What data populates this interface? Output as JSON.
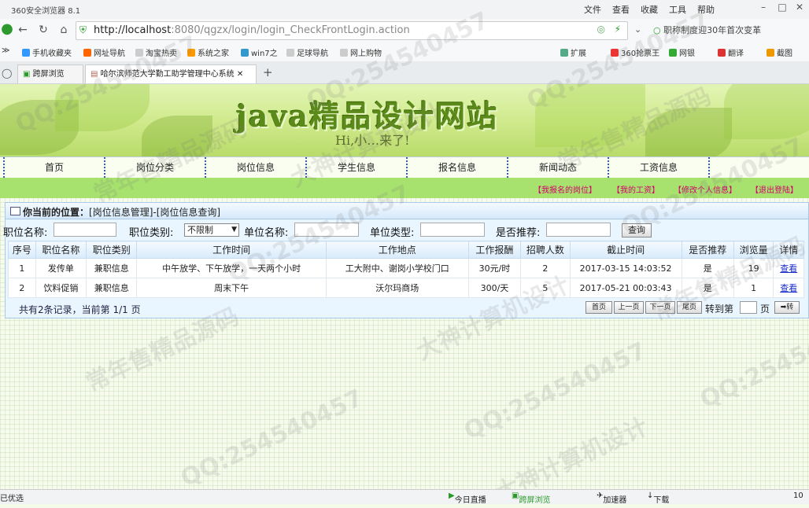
{
  "browser": {
    "app_title": "360安全浏览器 8.1",
    "menu": [
      "文件",
      "查看",
      "收藏",
      "工具",
      "帮助"
    ],
    "url_host": "http://localhost",
    "url_rest": ":8080/qgzx/login/login_CheckFrontLogin.action",
    "search_text": "职称制度迎30年首次变革",
    "bookmarks": [
      "手机收藏夹",
      "网址导航",
      "淘宝热卖",
      "系统之家",
      "win7之",
      "足球导航",
      "网上购物"
    ],
    "bookmarks_right": [
      "扩展",
      "360抢票王",
      "网银",
      "翻译",
      "截图"
    ],
    "tabs": [
      "跨屏浏览",
      "哈尔滨师范大学勤工助学管理中心系统"
    ],
    "new_tab": "+",
    "status_left": "已优选",
    "status_items": [
      "今日直播",
      "跨屏浏览",
      "加速器",
      "下载"
    ],
    "status_zoom": "10"
  },
  "site": {
    "title": "java精品设计网站",
    "subtitle": "Hi,小…来了!",
    "nav": [
      "首页",
      "岗位分类",
      "岗位信息",
      "学生信息",
      "报名信息",
      "新闻动态",
      "工资信息"
    ],
    "subnav": [
      "【我报名的岗位】",
      "【我的工资】",
      "【修改个人信息】",
      "【退出登陆】"
    ]
  },
  "panel": {
    "position_label": "你当前的位置：",
    "position_value": "[岗位信息管理]-[岗位信息查询]"
  },
  "search": {
    "name_label": "职位名称:",
    "type_label": "职位类别:",
    "type_value": "不限制",
    "unit_label": "单位名称:",
    "unit_type_label": "单位类型:",
    "recommend_label": "是否推荐:",
    "query_button": "查询"
  },
  "table": {
    "headers": [
      "序号",
      "职位名称",
      "职位类别",
      "工作时间",
      "工作地点",
      "工作报酬",
      "招聘人数",
      "截止时间",
      "是否推荐",
      "浏览量",
      "详情"
    ],
    "rows": [
      [
        "1",
        "发传单",
        "兼职信息",
        "中午放学、下午放学，一天两个小时",
        "工大附中、谢岗小学校门口",
        "30元/时",
        "2",
        "2017-03-15 14:03:52",
        "是",
        "19",
        "查看"
      ],
      [
        "2",
        "饮料促销",
        "兼职信息",
        "周末下午",
        "沃尔玛商场",
        "300/天",
        "5",
        "2017-05-21 00:03:43",
        "是",
        "1",
        "查看"
      ]
    ]
  },
  "pager": {
    "info": "共有2条记录，当前第 1/1 页",
    "first": "首页",
    "prev": "上一页",
    "next": "下一页",
    "last": "尾页",
    "goto_label": "转到第",
    "page_unit": "页",
    "go_button": "➡转"
  },
  "watermarks": [
    "QQ:254540457",
    "常年售精品源码",
    "大神计算机设计"
  ]
}
